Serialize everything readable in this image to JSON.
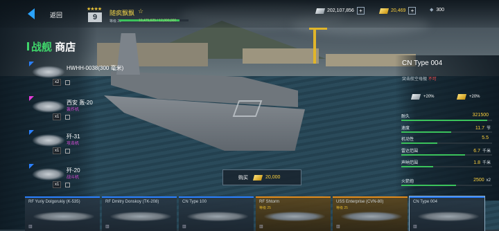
{
  "topbar": {
    "back_label": "返回",
    "rank": "9",
    "player_name": "随疯飘飘",
    "level_label": "等级 20",
    "xp_text": "10,475,625 / 12,000,000",
    "xp_fraction": 0.87,
    "silver": "202,107,856",
    "gold": "20,469",
    "premium": "300"
  },
  "panel": {
    "title_prefix": "战舰",
    "title_suffix": "商店",
    "units": [
      {
        "name": "HWHH-0038(300 毫米)",
        "type": "",
        "count": "x2",
        "flag": "blue"
      },
      {
        "name": "西安 轰-20",
        "type": "轰炸机",
        "count": "x1",
        "flag": "pink"
      },
      {
        "name": "歼-31",
        "type": "攻击机",
        "count": "x1",
        "flag": "blue"
      },
      {
        "name": "歼-20",
        "type": "战斗机",
        "count": "x1",
        "flag": "blue"
      }
    ]
  },
  "ship": {
    "name": "CN Type 004",
    "subtitle": "突击航空母舰",
    "subtitle_warn": "不可",
    "bonus_silver": "+20%",
    "bonus_gold": "+20%",
    "stats": [
      {
        "label": "耐久",
        "value": "321500",
        "unit": "",
        "fill": 0.95,
        "green": false
      },
      {
        "label": "速度",
        "value": "11.7",
        "unit": "节",
        "fill": 0.55,
        "green": false
      },
      {
        "label": "机动性",
        "value": "5.5",
        "unit": "",
        "fill": 0.4,
        "green": false
      },
      {
        "label": "雷达范围",
        "value": "6.7",
        "unit": "千米",
        "fill": 0.7,
        "green": false
      },
      {
        "label": "声呐范围",
        "value": "1.8",
        "unit": "千米",
        "fill": 0.35,
        "green": false
      },
      {
        "label": "火箭炮",
        "value": "2500",
        "unit": "x2",
        "fill": 0.6,
        "green": false
      }
    ]
  },
  "buy": {
    "label": "购买",
    "price": "20,000"
  },
  "bottom": [
    {
      "name": "RF Yuriy Dolgorukiy (K-535)",
      "level": "",
      "gold": false
    },
    {
      "name": "RF Dmitry Donskoy (TK-208)",
      "level": "",
      "gold": false
    },
    {
      "name": "CN Type 100",
      "level": "",
      "gold": false
    },
    {
      "name": "RF Shtorm",
      "level": "等级 25",
      "gold": true
    },
    {
      "name": "USS Enterprise (CVN-80)",
      "level": "等级 25",
      "gold": true
    },
    {
      "name": "CN Type 004",
      "level": "",
      "gold": false
    }
  ]
}
